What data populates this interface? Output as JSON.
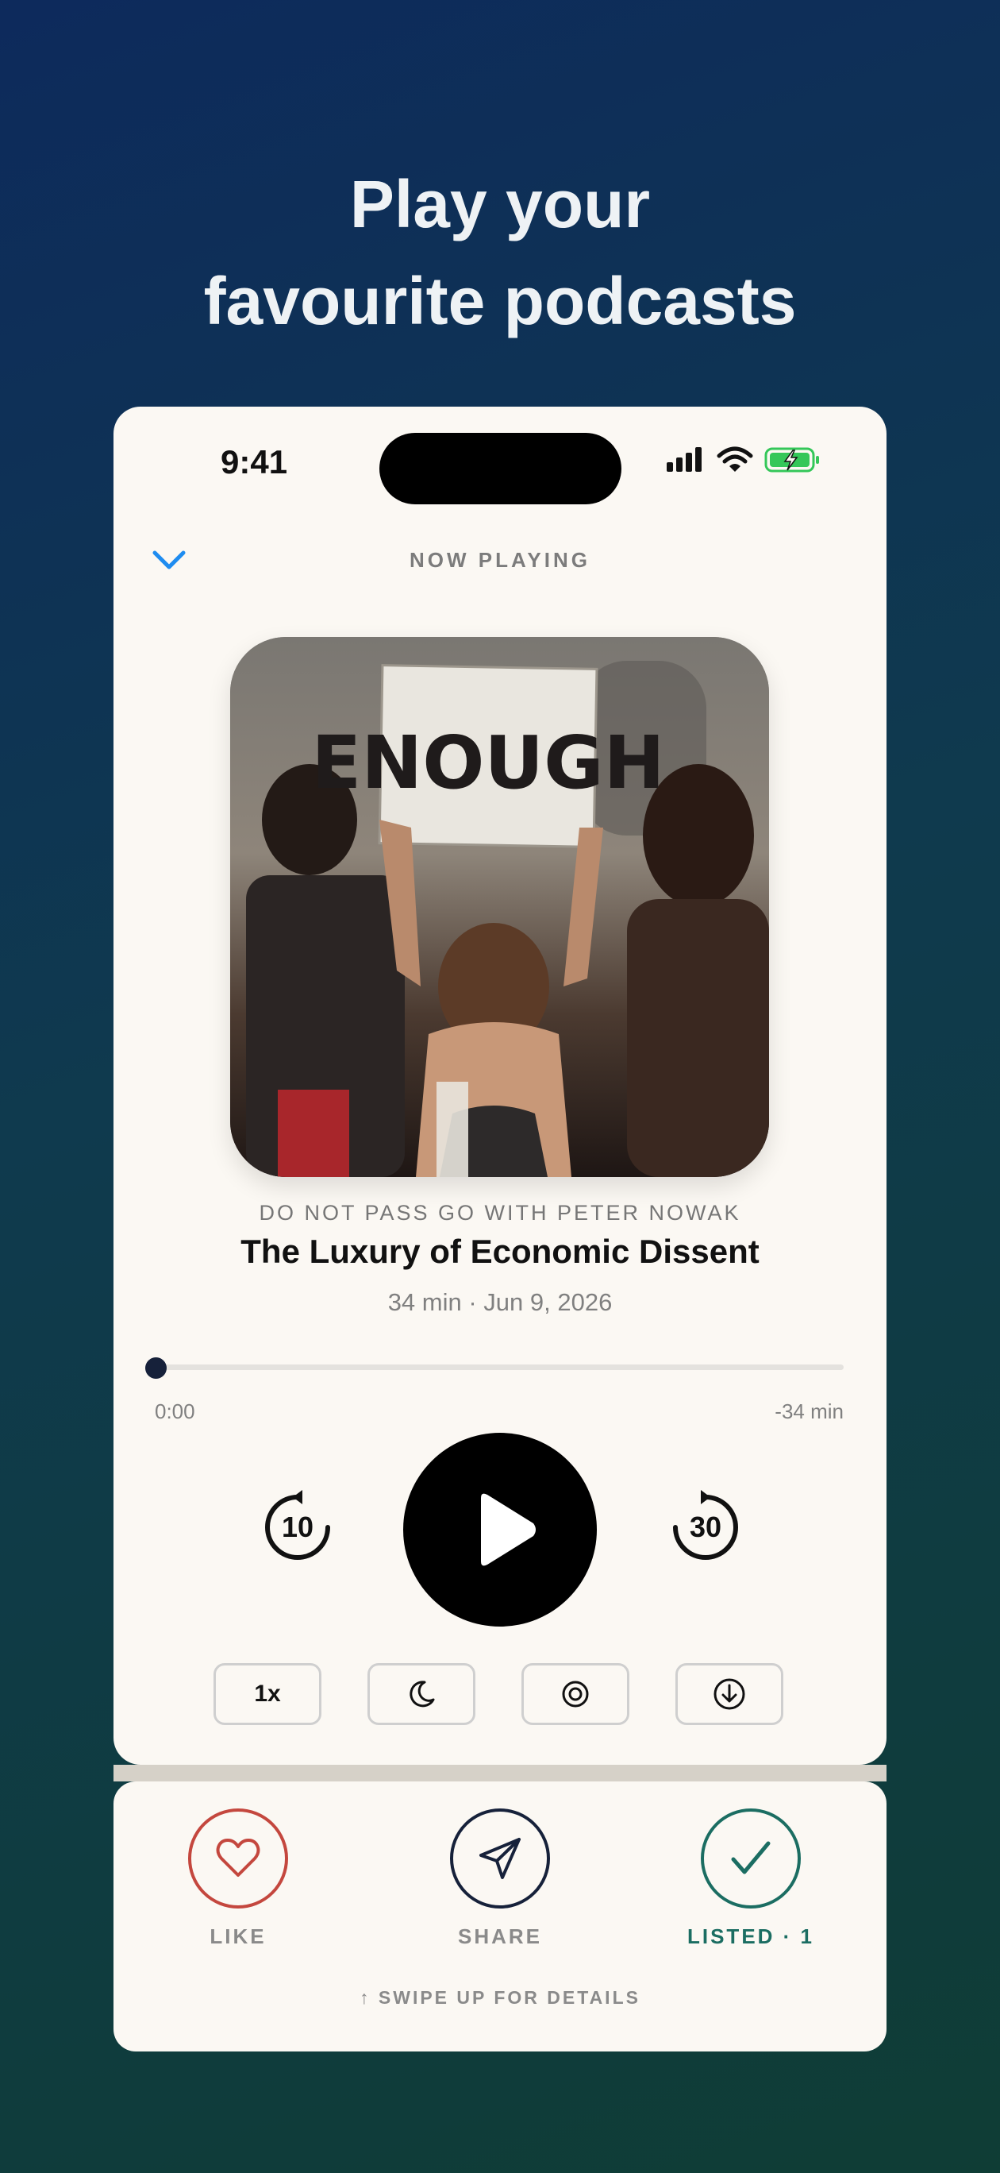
{
  "headline": {
    "line1": "Play your",
    "line2": "favourite podcasts"
  },
  "status_bar": {
    "time": "9:41",
    "icons": [
      "cellular-signal-icon",
      "wifi-icon",
      "battery-charging-icon"
    ]
  },
  "header": {
    "collapse_icon": "chevron-down-icon",
    "title": "NOW PLAYING"
  },
  "episode": {
    "artwork_icon": "podcast-artwork",
    "sign_text": "ENOUGH",
    "podcast": "DO NOT PASS GO WITH PETER NOWAK",
    "title": "The Luxury of Economic Dissent",
    "meta": "34 min · Jun 9, 2026"
  },
  "progress": {
    "value": 0,
    "elapsed": "0:00",
    "remaining": "-34 min"
  },
  "controls": {
    "skip_back_label": "10",
    "skip_forward_label": "30",
    "play_icon": "play-icon"
  },
  "options": {
    "speed": "1x",
    "sleep_icon": "moon-icon",
    "queue_icon": "target-icon",
    "download_icon": "download-icon"
  },
  "actions": {
    "like": "LIKE",
    "share": "SHARE",
    "listed": "LISTED · 1",
    "swipe_hint": "↑ SWIPE UP FOR DETAILS"
  },
  "colors": {
    "accent_blue": "#1e8cf0",
    "like_red": "#c4473e",
    "share_navy": "#16213a",
    "listed_teal": "#1b6d62",
    "battery_green": "#34c759"
  }
}
